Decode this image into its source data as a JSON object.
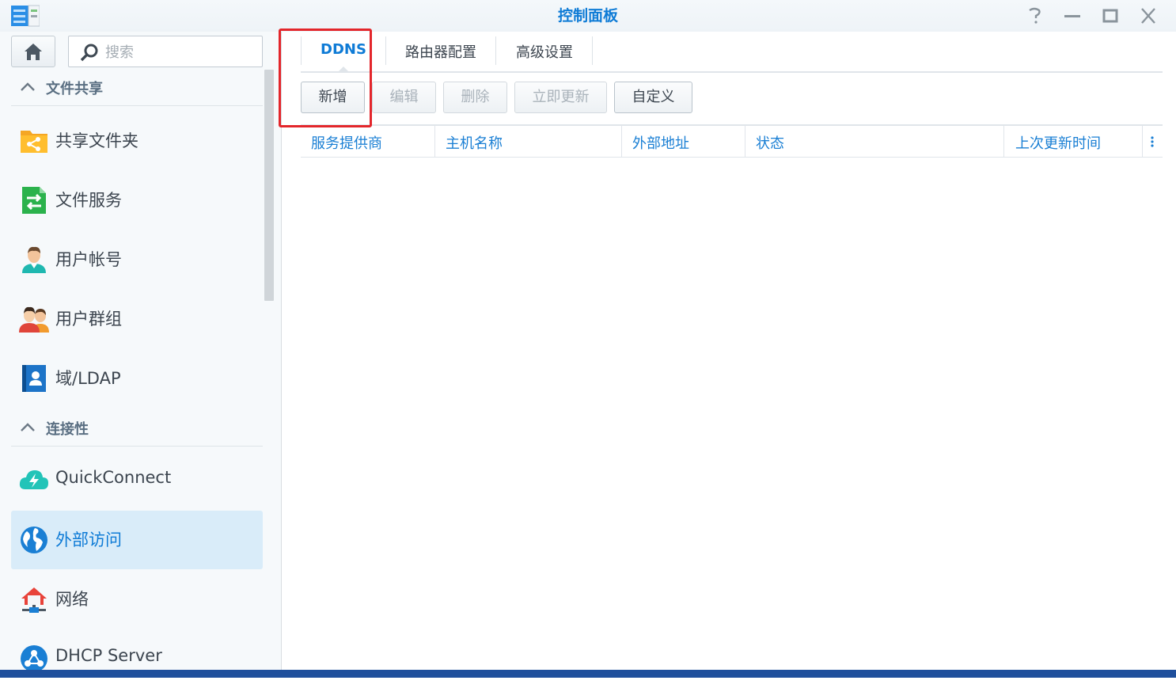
{
  "window": {
    "title": "控制面板",
    "controls": [
      "help-icon",
      "minimize-icon",
      "maximize-icon",
      "close-icon"
    ]
  },
  "sidebar": {
    "search_placeholder": "搜索",
    "sections": [
      {
        "label": "文件共享",
        "items": [
          {
            "label": "共享文件夹",
            "icon": "shared-folder-icon"
          },
          {
            "label": "文件服务",
            "icon": "file-services-icon"
          },
          {
            "label": "用户帐号",
            "icon": "user-icon"
          },
          {
            "label": "用户群组",
            "icon": "group-icon"
          },
          {
            "label": "域/LDAP",
            "icon": "domain-ldap-icon"
          }
        ]
      },
      {
        "label": "连接性",
        "items": [
          {
            "label": "QuickConnect",
            "icon": "quickconnect-icon"
          },
          {
            "label": "外部访问",
            "icon": "external-access-icon",
            "active": true
          },
          {
            "label": "网络",
            "icon": "network-icon"
          },
          {
            "label": "DHCP Server",
            "icon": "dhcp-server-icon"
          }
        ]
      }
    ]
  },
  "main": {
    "tabs": [
      {
        "label": "DDNS",
        "active": true
      },
      {
        "label": "路由器配置"
      },
      {
        "label": "高级设置"
      }
    ],
    "toolbar": {
      "add": "新增",
      "edit": "编辑",
      "delete": "删除",
      "update_now": "立即更新",
      "customize": "自定义"
    },
    "columns": [
      "服务提供商",
      "主机名称",
      "外部地址",
      "状态",
      "上次更新时间"
    ]
  },
  "colors": {
    "accent": "#0e7bd6",
    "highlight_box": "#e3262b",
    "active_item_bg": "#d9ecf9"
  }
}
